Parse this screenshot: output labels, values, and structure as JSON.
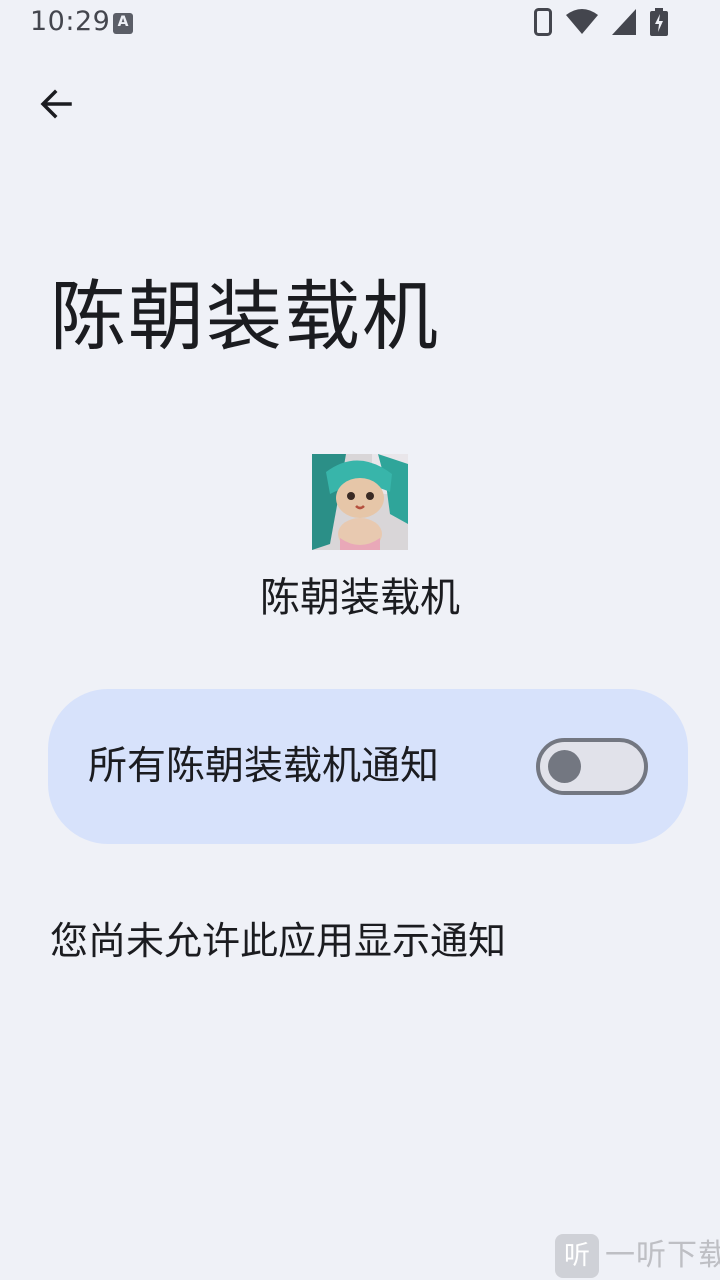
{
  "status_bar": {
    "time": "10:29",
    "notification_icon_letter": "A",
    "icons": [
      "phone-icon",
      "wifi-icon",
      "signal-icon",
      "battery-charging-icon"
    ]
  },
  "header": {
    "back_icon": "arrow-left-icon"
  },
  "page": {
    "title": "陈朝装载机"
  },
  "app": {
    "name": "陈朝装载机",
    "icon": "app-icon"
  },
  "notification_toggle": {
    "label": "所有陈朝装载机通知",
    "enabled": false
  },
  "message": "您尚未允许此应用显示通知",
  "watermark": {
    "badge": "听",
    "text": "一听下载"
  },
  "colors": {
    "background": "#eff1f7",
    "card": "#d7e2fb",
    "switch_outline": "#737781",
    "text": "#1b1c20"
  }
}
